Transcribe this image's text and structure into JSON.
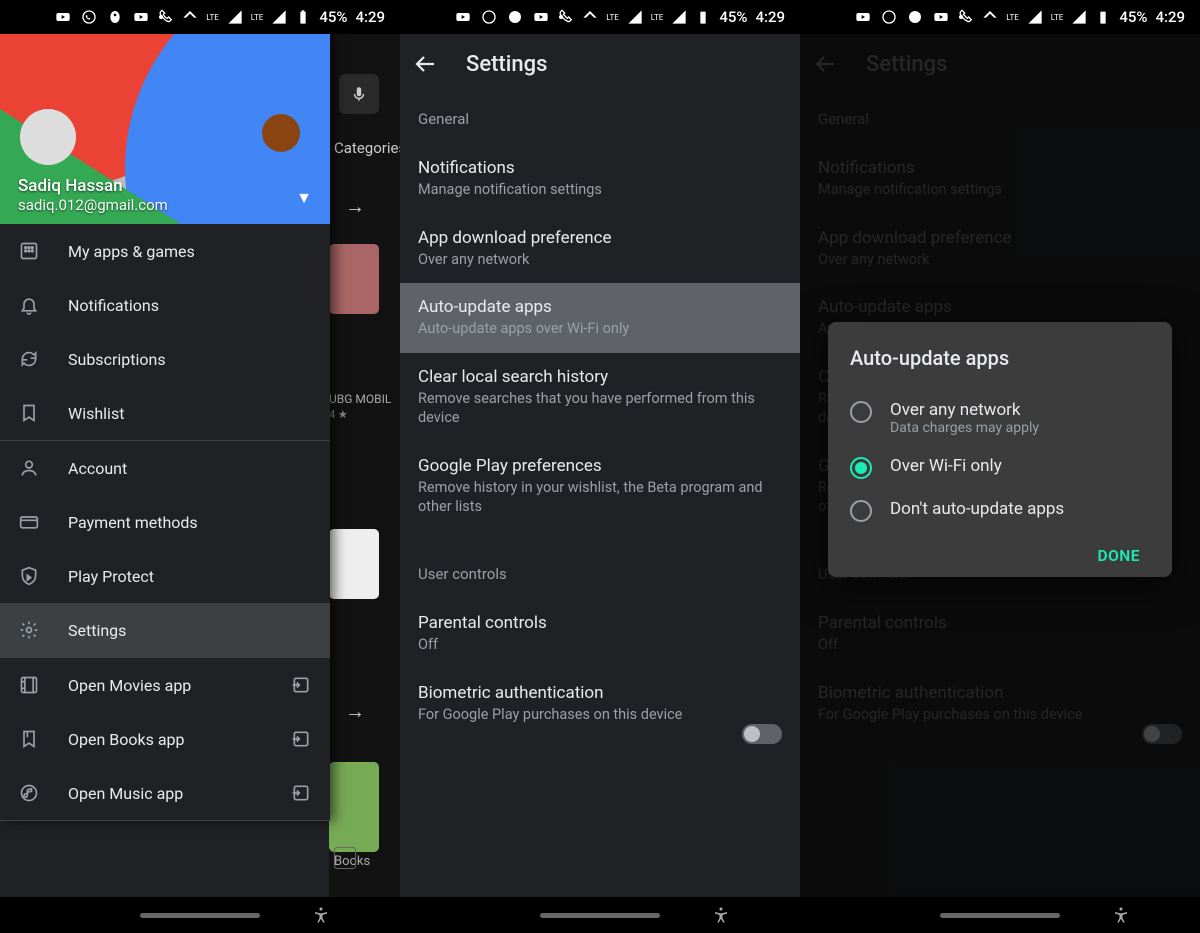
{
  "status": {
    "battery": "45%",
    "time": "4:29",
    "lte": "LTE"
  },
  "drawer": {
    "name": "Sadiq Hassan",
    "email": "sadiq.012@gmail.com",
    "items": [
      {
        "icon": "apps",
        "label": "My apps & games"
      },
      {
        "icon": "bell",
        "label": "Notifications"
      },
      {
        "icon": "refresh",
        "label": "Subscriptions"
      },
      {
        "icon": "bookmark",
        "label": "Wishlist"
      }
    ],
    "items2": [
      {
        "icon": "person",
        "label": "Account"
      },
      {
        "icon": "card",
        "label": "Payment methods"
      },
      {
        "icon": "shield",
        "label": "Play Protect"
      },
      {
        "icon": "gear",
        "label": "Settings",
        "selected": true
      }
    ],
    "items3": [
      {
        "icon": "film",
        "label": "Open Movies app",
        "open": true
      },
      {
        "icon": "book",
        "label": "Open Books app",
        "open": true
      },
      {
        "icon": "music",
        "label": "Open Music app",
        "open": true
      }
    ],
    "bg": {
      "categories": "Categories",
      "pubg": "UBG MOBIL",
      "star": "4 ★",
      "books": "Books"
    }
  },
  "settings": {
    "title": "Settings",
    "general": "General",
    "items": [
      {
        "title": "Notifications",
        "sub": "Manage notification settings"
      },
      {
        "title": "App download preference",
        "sub": "Over any network"
      },
      {
        "title": "Auto-update apps",
        "sub": "Auto-update apps over Wi-Fi only",
        "hl": true
      },
      {
        "title": "Clear local search history",
        "sub": "Remove searches that you have performed from this device"
      },
      {
        "title": "Google Play preferences",
        "sub": "Remove history in your wishlist, the Beta program and other lists"
      }
    ],
    "user_controls": "User controls",
    "uc_items": [
      {
        "title": "Parental controls",
        "sub": "Off"
      },
      {
        "title": "Biometric authentication",
        "sub": "For Google Play purchases on this device",
        "switch": true
      }
    ]
  },
  "dialog": {
    "title": "Auto-update apps",
    "options": [
      {
        "label": "Over any network",
        "sub": "Data charges may apply"
      },
      {
        "label": "Over Wi-Fi only",
        "selected": true
      },
      {
        "label": "Don't auto-update apps"
      }
    ],
    "done": "DONE"
  }
}
